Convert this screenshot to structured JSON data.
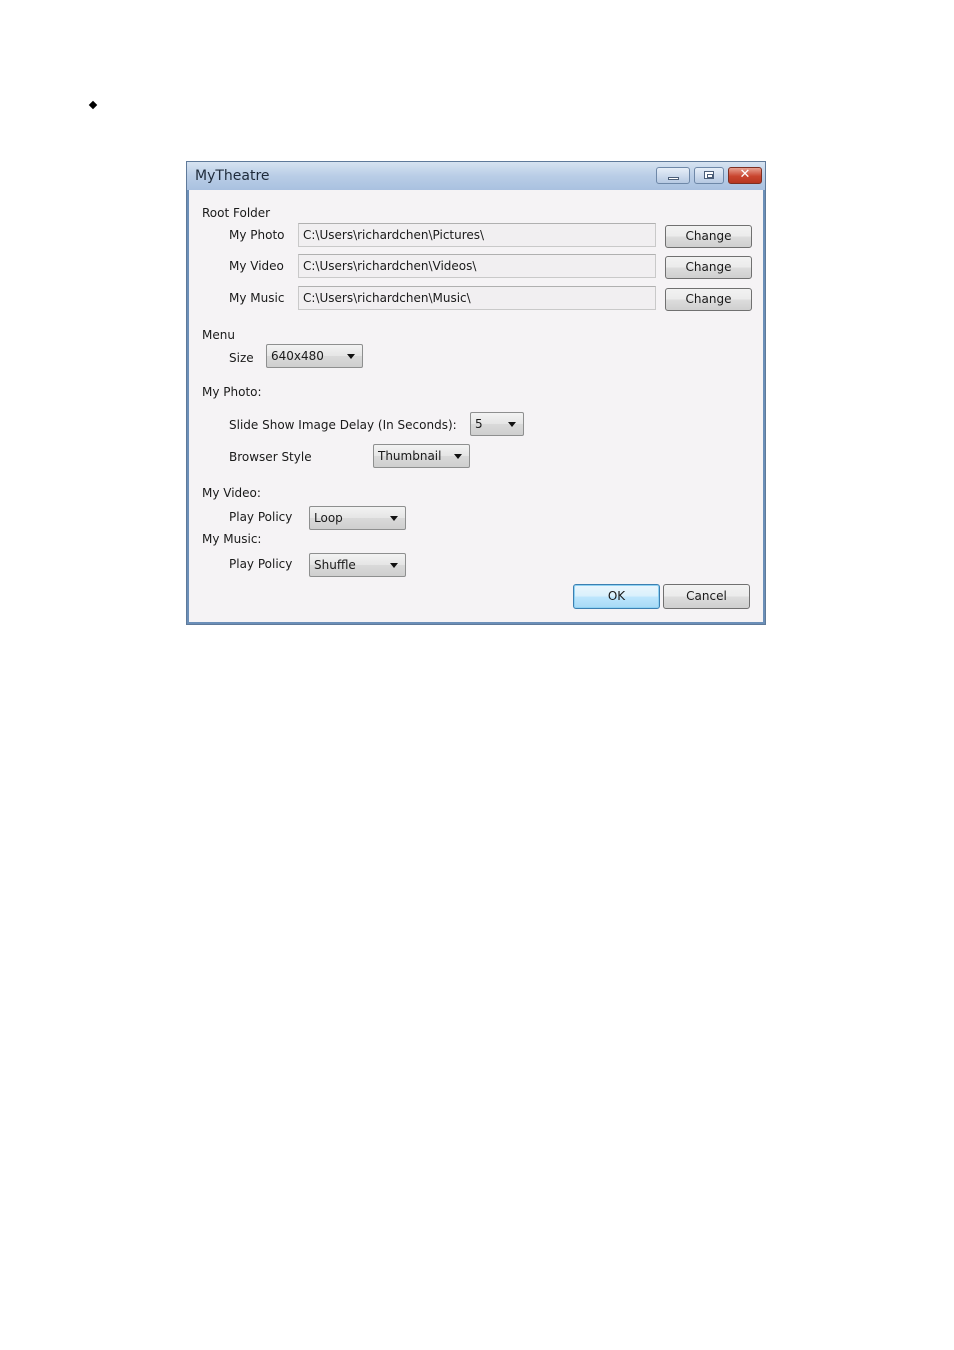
{
  "page": {
    "bullet_icon": "diamond-bullet"
  },
  "window": {
    "title": "MyTheatre",
    "controls": {
      "minimize_icon": "minimize-icon",
      "maximize_icon": "maximize-icon",
      "close_icon": "close-icon",
      "close_glyph": "✕"
    }
  },
  "root_folder": {
    "heading": "Root Folder",
    "rows": [
      {
        "label": "My Photo",
        "value": "C:\\Users\\richardchen\\Pictures\\",
        "button": "Change"
      },
      {
        "label": "My Video",
        "value": "C:\\Users\\richardchen\\Videos\\",
        "button": "Change"
      },
      {
        "label": "My Music",
        "value": "C:\\Users\\richardchen\\Music\\",
        "button": "Change"
      }
    ]
  },
  "menu": {
    "heading": "Menu",
    "size_label": "Size",
    "size_value": "640x480"
  },
  "my_photo": {
    "heading": "My Photo:",
    "delay_label": "Slide Show Image Delay (In Seconds):",
    "delay_value": "5",
    "browser_style_label": "Browser Style",
    "browser_style_value": "Thumbnail"
  },
  "my_video": {
    "heading": "My Video:",
    "play_policy_label": "Play Policy",
    "play_policy_value": "Loop"
  },
  "my_music": {
    "heading": "My Music:",
    "play_policy_label": "Play Policy",
    "play_policy_value": "Shuffle"
  },
  "footer": {
    "ok_label": "OK",
    "cancel_label": "Cancel"
  }
}
